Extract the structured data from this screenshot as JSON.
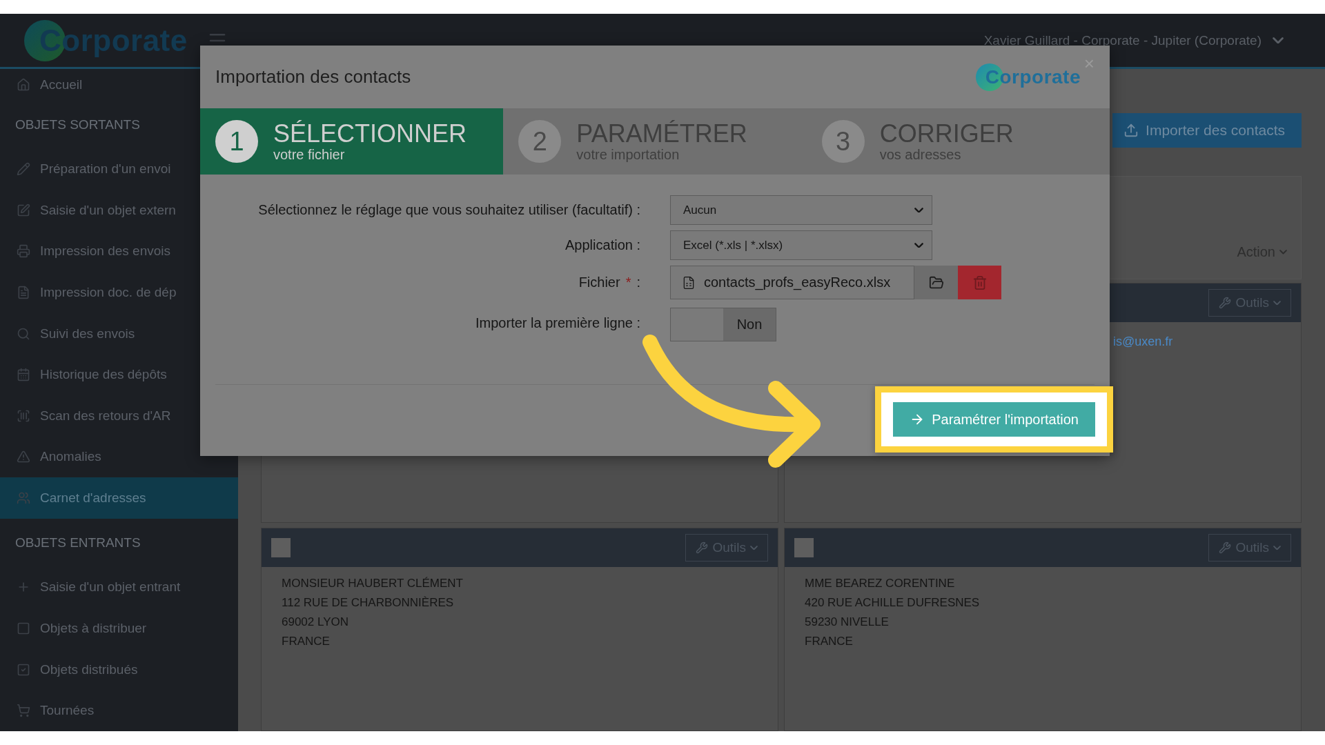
{
  "header": {
    "logo": "Corporate",
    "user_menu": "Xavier Guillard - Corporate - Jupiter (Corporate)"
  },
  "sidebar": {
    "items": [
      {
        "kind": "link",
        "label": "Accueil",
        "selected": false
      },
      {
        "kind": "section",
        "label": "OBJETS SORTANTS"
      },
      {
        "kind": "link",
        "label": "Préparation d'un envoi",
        "selected": false
      },
      {
        "kind": "link",
        "label": "Saisie d'un objet extern",
        "selected": false
      },
      {
        "kind": "link",
        "label": "Impression des envois",
        "selected": false
      },
      {
        "kind": "link",
        "label": "Impression doc. de dép",
        "selected": false
      },
      {
        "kind": "link",
        "label": "Suivi des envois",
        "selected": false
      },
      {
        "kind": "link",
        "label": "Historique des dépôts",
        "selected": false
      },
      {
        "kind": "link",
        "label": "Scan des retours d'AR",
        "selected": false
      },
      {
        "kind": "link",
        "label": "Anomalies",
        "selected": false
      },
      {
        "kind": "link",
        "label": "Carnet d'adresses",
        "selected": true
      },
      {
        "kind": "section",
        "label": "OBJETS ENTRANTS"
      },
      {
        "kind": "link",
        "label": "Saisie d'un objet entrant",
        "selected": false
      },
      {
        "kind": "link",
        "label": "Objets à distribuer",
        "selected": false
      },
      {
        "kind": "link",
        "label": "Objets distribués",
        "selected": false
      },
      {
        "kind": "link",
        "label": "Tournées",
        "selected": false
      }
    ]
  },
  "main": {
    "import_button": "Importer des contacts",
    "action_menu": "Action",
    "cards": [
      {
        "kind": "hidden"
      },
      {
        "kind": "email",
        "tools": "Outils",
        "email": "is@uxen.fr"
      },
      {
        "kind": "address",
        "tools": "Outils",
        "checked": false,
        "lines": [
          "MONSIEUR HAUBERT CLÉMENT",
          "112 RUE DE CHARBONNIÈRES",
          "69002 LYON",
          "FRANCE"
        ]
      },
      {
        "kind": "address",
        "tools": "Outils",
        "checked": false,
        "lines": [
          "MME BEAREZ CORENTINE",
          "420 RUE ACHILLE DUFRESNES",
          "59230 NIVELLE",
          "FRANCE"
        ]
      }
    ]
  },
  "modal": {
    "title": "Importation des contacts",
    "logo": "Corporate",
    "close": "×",
    "steps": [
      {
        "number": "1",
        "title": "SÉLECTIONNER",
        "subtitle": "votre fichier",
        "selected": true
      },
      {
        "number": "2",
        "title": "PARAMÉTRER",
        "subtitle": "votre importation",
        "selected": false
      },
      {
        "number": "3",
        "title": "CORRIGER",
        "subtitle": "vos adresses",
        "selected": false
      }
    ],
    "fields": [
      {
        "kind": "select",
        "label": "Sélectionnez le réglage que vous souhaitez utiliser (facultatif) :",
        "value": "Aucun"
      },
      {
        "kind": "select",
        "label": "Application :",
        "value": "Excel (*.xls | *.xlsx)"
      },
      {
        "kind": "file",
        "label": "Fichier",
        "required": "*",
        "suffix": ":",
        "value": "contacts_profs_easyReco.xlsx"
      },
      {
        "kind": "toggle",
        "label": "Importer la première ligne :",
        "on": false,
        "value": "Non"
      }
    ],
    "submit": "Paramétrer l'importation"
  }
}
